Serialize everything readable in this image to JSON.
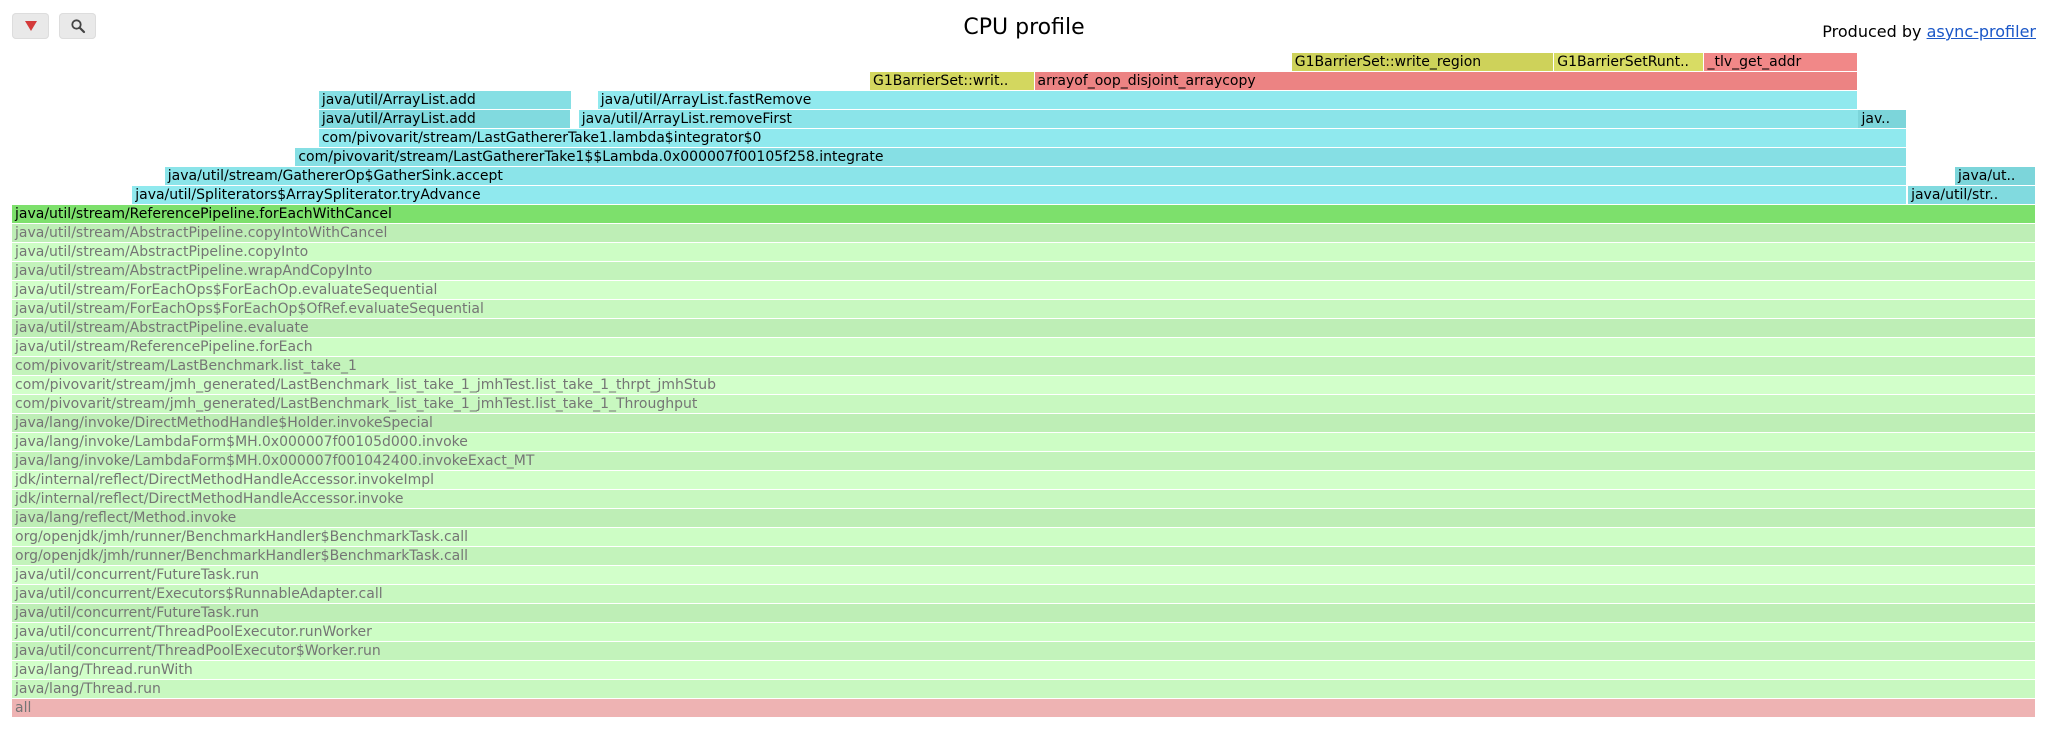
{
  "header": {
    "title": "CPU profile",
    "produced_prefix": "Produced by ",
    "produced_link": "async-profiler"
  },
  "colors": {
    "green_dim": "#c8f8c0",
    "green_bright": "#7de06c",
    "teal": "#86dfe4",
    "yellow": "#d8dc64",
    "red": "#e77e7e",
    "root": "#eeb3b3",
    "dim_text": "#757575"
  },
  "frames": [
    {
      "row": 0,
      "label": "all",
      "start": 0,
      "width": 1,
      "type": "root"
    },
    {
      "row": 1,
      "label": "java/lang/Thread.run",
      "start": 0,
      "width": 1,
      "type": "dim"
    },
    {
      "row": 2,
      "label": "java/lang/Thread.runWith",
      "start": 0,
      "width": 1,
      "type": "dim"
    },
    {
      "row": 3,
      "label": "java/util/concurrent/ThreadPoolExecutor$Worker.run",
      "start": 0,
      "width": 1,
      "type": "dim"
    },
    {
      "row": 4,
      "label": "java/util/concurrent/ThreadPoolExecutor.runWorker",
      "start": 0,
      "width": 1,
      "type": "dim"
    },
    {
      "row": 5,
      "label": "java/util/concurrent/FutureTask.run",
      "start": 0,
      "width": 1,
      "type": "dim"
    },
    {
      "row": 6,
      "label": "java/util/concurrent/Executors$RunnableAdapter.call",
      "start": 0,
      "width": 1,
      "type": "dim"
    },
    {
      "row": 7,
      "label": "java/util/concurrent/FutureTask.run",
      "start": 0,
      "width": 1,
      "type": "dim"
    },
    {
      "row": 8,
      "label": "org/openjdk/jmh/runner/BenchmarkHandler$BenchmarkTask.call",
      "start": 0,
      "width": 1,
      "type": "dim"
    },
    {
      "row": 9,
      "label": "org/openjdk/jmh/runner/BenchmarkHandler$BenchmarkTask.call",
      "start": 0,
      "width": 1,
      "type": "dim"
    },
    {
      "row": 10,
      "label": "java/lang/reflect/Method.invoke",
      "start": 0,
      "width": 1,
      "type": "dim"
    },
    {
      "row": 11,
      "label": "jdk/internal/reflect/DirectMethodHandleAccessor.invoke",
      "start": 0,
      "width": 1,
      "type": "dim"
    },
    {
      "row": 12,
      "label": "jdk/internal/reflect/DirectMethodHandleAccessor.invokeImpl",
      "start": 0,
      "width": 1,
      "type": "dim"
    },
    {
      "row": 13,
      "label": "java/lang/invoke/LambdaForm$MH.0x000007f001042400.invokeExact_MT",
      "start": 0,
      "width": 1,
      "type": "dim"
    },
    {
      "row": 14,
      "label": "java/lang/invoke/LambdaForm$MH.0x000007f00105d000.invoke",
      "start": 0,
      "width": 1,
      "type": "dim"
    },
    {
      "row": 15,
      "label": "java/lang/invoke/DirectMethodHandle$Holder.invokeSpecial",
      "start": 0,
      "width": 1,
      "type": "dim"
    },
    {
      "row": 16,
      "label": "com/pivovarit/stream/jmh_generated/LastBenchmark_list_take_1_jmhTest.list_take_1_Throughput",
      "start": 0,
      "width": 1,
      "type": "dim"
    },
    {
      "row": 17,
      "label": "com/pivovarit/stream/jmh_generated/LastBenchmark_list_take_1_jmhTest.list_take_1_thrpt_jmhStub",
      "start": 0,
      "width": 1,
      "type": "dim"
    },
    {
      "row": 18,
      "label": "com/pivovarit/stream/LastBenchmark.list_take_1",
      "start": 0,
      "width": 1,
      "type": "dim"
    },
    {
      "row": 19,
      "label": "java/util/stream/ReferencePipeline.forEach",
      "start": 0,
      "width": 1,
      "type": "dim"
    },
    {
      "row": 20,
      "label": "java/util/stream/AbstractPipeline.evaluate",
      "start": 0,
      "width": 1,
      "type": "dim"
    },
    {
      "row": 21,
      "label": "java/util/stream/ForEachOps$ForEachOp$OfRef.evaluateSequential",
      "start": 0,
      "width": 1,
      "type": "dim"
    },
    {
      "row": 22,
      "label": "java/util/stream/ForEachOps$ForEachOp.evaluateSequential",
      "start": 0,
      "width": 1,
      "type": "dim"
    },
    {
      "row": 23,
      "label": "java/util/stream/AbstractPipeline.wrapAndCopyInto",
      "start": 0,
      "width": 1,
      "type": "dim"
    },
    {
      "row": 24,
      "label": "java/util/stream/AbstractPipeline.copyInto",
      "start": 0,
      "width": 1,
      "type": "dim"
    },
    {
      "row": 25,
      "label": "java/util/stream/AbstractPipeline.copyIntoWithCancel",
      "start": 0,
      "width": 1,
      "type": "dim"
    },
    {
      "row": 26,
      "label": "java/util/stream/ReferencePipeline.forEachWithCancel",
      "start": 0,
      "width": 1,
      "type": "bright"
    },
    {
      "row": 27,
      "label": "java/util/Spliterators$ArraySpliterator.tryAdvance",
      "start": 0.0594,
      "width": 0.8768,
      "type": "teal"
    },
    {
      "row": 27,
      "label": "java/util/str..",
      "start": 0.9368,
      "width": 0.0632,
      "type": "teal"
    },
    {
      "row": 28,
      "label": "java/util/stream/GathererOp$GatherSink.accept",
      "start": 0.0755,
      "width": 0.8607,
      "type": "teal"
    },
    {
      "row": 28,
      "label": "java/ut..",
      "start": 0.96,
      "width": 0.04,
      "type": "teal"
    },
    {
      "row": 29,
      "label": "com/pivovarit/stream/LastGathererTake1$$Lambda.0x000007f00105f258.integrate",
      "start": 0.14,
      "width": 0.7962,
      "type": "teal"
    },
    {
      "row": 30,
      "label": "com/pivovarit/stream/LastGathererTake1.lambda$integrator$0",
      "start": 0.1516,
      "width": 0.7846,
      "type": "teal"
    },
    {
      "row": 31,
      "label": "java/util/ArrayList.add",
      "start": 0.1516,
      "width": 0.1247,
      "type": "teal"
    },
    {
      "row": 31,
      "label": "java/util/ArrayList.removeFirst",
      "start": 0.28,
      "width": 0.6326,
      "type": "teal"
    },
    {
      "row": 31,
      "label": "jav..",
      "start": 0.9123,
      "width": 0.0239,
      "type": "teal"
    },
    {
      "row": 32,
      "label": "java/util/ArrayList.add",
      "start": 0.1516,
      "width": 0.1252,
      "type": "teal"
    },
    {
      "row": 32,
      "label": "java/util/ArrayList.fastRemove",
      "start": 0.2894,
      "width": 0.6229,
      "type": "teal"
    },
    {
      "row": 33,
      "label": "G1BarrierSet::writ..",
      "start": 0.4239,
      "width": 0.0813,
      "type": "yellow"
    },
    {
      "row": 33,
      "label": "arrayof_oop_disjoint_arraycopy",
      "start": 0.5052,
      "width": 0.4071,
      "type": "red"
    },
    {
      "row": 34,
      "label": "G1BarrierSet::write_region",
      "start": 0.6323,
      "width": 0.1297,
      "type": "yellow"
    },
    {
      "row": 34,
      "label": "G1BarrierSetRunt..",
      "start": 0.762,
      "width": 0.0742,
      "type": "yellow"
    },
    {
      "row": 34,
      "label": "_tlv_get_addr",
      "start": 0.8362,
      "width": 0.0761,
      "type": "red"
    }
  ]
}
